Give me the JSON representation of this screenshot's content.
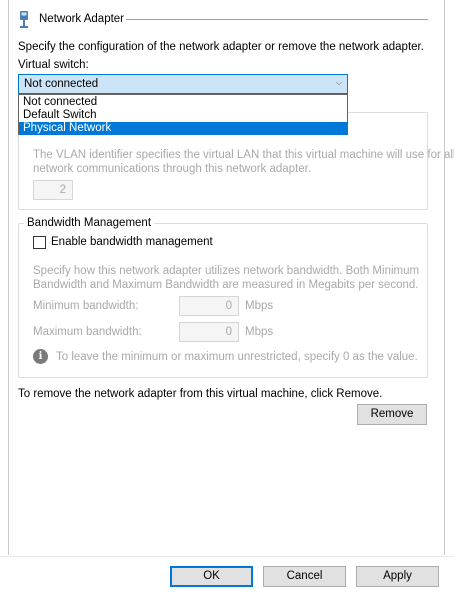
{
  "section": {
    "title": "Network Adapter"
  },
  "description": "Specify the configuration of the network adapter or remove the network adapter.",
  "virtual_switch": {
    "label": "Virtual switch:",
    "selected": "Not connected",
    "options": [
      {
        "label": "Not connected",
        "selected": false
      },
      {
        "label": "Default Switch",
        "selected": false
      },
      {
        "label": "Physical Network",
        "selected": true
      }
    ]
  },
  "vlan": {
    "description_line1": "The VLAN identifier specifies the virtual LAN that this virtual machine will use for all",
    "description_line2": "network communications through this network adapter.",
    "value": "2"
  },
  "bandwidth": {
    "group_title": "Bandwidth Management",
    "enable_label": "Enable bandwidth management",
    "enabled": false,
    "description_line1": "Specify how this network adapter utilizes network bandwidth. Both Minimum",
    "description_line2": "Bandwidth and Maximum Bandwidth are measured in Megabits per second.",
    "min_label": "Minimum bandwidth:",
    "min_value": "0",
    "max_label": "Maximum bandwidth:",
    "max_value": "0",
    "unit": "Mbps",
    "info_text": "To leave the minimum or maximum unrestricted, specify 0 as the value."
  },
  "remove": {
    "description": "To remove the network adapter from this virtual machine, click Remove.",
    "button_label": "Remove"
  },
  "footer": {
    "ok_label": "OK",
    "cancel_label": "Cancel",
    "apply_label": "Apply"
  },
  "colors": {
    "accent": "#0078d7",
    "disabled_text": "#a9a9a9"
  }
}
